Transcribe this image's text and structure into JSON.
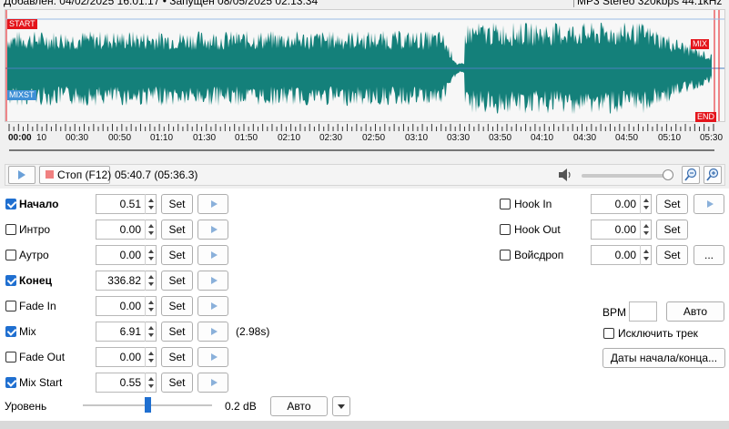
{
  "info": {
    "added_text": "Добавлен: 04/02/2025 16:01:17 • Запущен 08/05/2025 02:13:34",
    "format_text": "MP3 Stereo 320kbps 44.1kHz"
  },
  "waveform": {
    "color": "#14807a",
    "markers": {
      "start": "START",
      "mixst": "MIXST",
      "mix": "MIX",
      "end": "END"
    }
  },
  "ruler": {
    "labels": [
      "00:00",
      "10",
      "00:30",
      "00:50",
      "01:10",
      "01:30",
      "01:50",
      "02:10",
      "02:30",
      "02:50",
      "03:10",
      "03:30",
      "03:50",
      "04:10",
      "04:30",
      "04:50",
      "05:10",
      "05:30"
    ]
  },
  "transport": {
    "stop_label": "Стоп (F12)",
    "time_text": "05:40.7  (05:36.3)",
    "volume_level": 0.95
  },
  "rows_left": [
    {
      "label": "Начало",
      "bold": true,
      "checked": true,
      "value": "0.51",
      "set": "Set",
      "play": true,
      "note": ""
    },
    {
      "label": "Интро",
      "bold": false,
      "checked": false,
      "value": "0.00",
      "set": "Set",
      "play": true,
      "note": ""
    },
    {
      "label": "Аутро",
      "bold": false,
      "checked": false,
      "value": "0.00",
      "set": "Set",
      "play": true,
      "note": ""
    },
    {
      "label": "Конец",
      "bold": true,
      "checked": true,
      "value": "336.82",
      "set": "Set",
      "play": true,
      "note": ""
    },
    {
      "label": "Fade In",
      "bold": false,
      "checked": false,
      "value": "0.00",
      "set": "Set",
      "play": true,
      "note": ""
    },
    {
      "label": "Mix",
      "bold": false,
      "checked": true,
      "value": "6.91",
      "set": "Set",
      "play": true,
      "note": "(2.98s)"
    },
    {
      "label": "Fade Out",
      "bold": false,
      "checked": false,
      "value": "0.00",
      "set": "Set",
      "play": true,
      "note": ""
    },
    {
      "label": "Mix Start",
      "bold": false,
      "checked": true,
      "value": "0.55",
      "set": "Set",
      "play": true,
      "note": ""
    }
  ],
  "rows_right": [
    {
      "label": "Hook In",
      "checked": false,
      "value": "0.00",
      "set": "Set",
      "extra": "play"
    },
    {
      "label": "Hook Out",
      "checked": false,
      "value": "0.00",
      "set": "Set",
      "extra": ""
    },
    {
      "label": "Войсдроп",
      "checked": false,
      "value": "0.00",
      "set": "Set",
      "extra": "..."
    }
  ],
  "bpm": {
    "label": "BPM",
    "value": "",
    "auto_label": "Авто"
  },
  "exclude_label": "Исключить трек",
  "dates_label": "Даты начала/конца...",
  "level": {
    "label": "Уровень",
    "value_text": "0.2 dB",
    "auto_label": "Авто",
    "level_fraction": 0.5
  }
}
